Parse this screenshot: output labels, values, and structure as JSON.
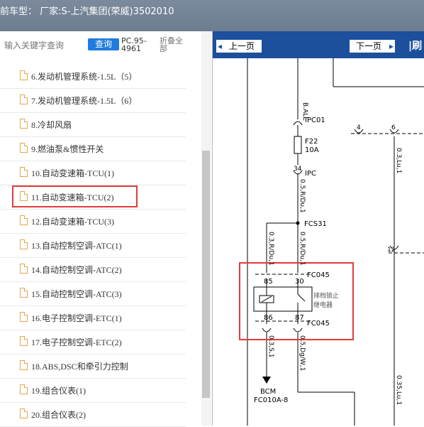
{
  "header": {
    "title": "前车型： 厂家:S-上汽集团(荣威)3502010"
  },
  "search": {
    "placeholder": "输入关键字查询",
    "button": "查询",
    "code": "PC.95-4961",
    "collapse": "折叠全部"
  },
  "tree": {
    "items": [
      {
        "label": "6.发动机管理系统-1.5L（5）"
      },
      {
        "label": "7.发动机管理系统-1.5L（6）"
      },
      {
        "label": "8.冷却风扇"
      },
      {
        "label": "9.燃油泵&惯性开关"
      },
      {
        "label": "10.自动变速箱-TCU(1)"
      },
      {
        "label": "11.自动变速箱-TCU(2)"
      },
      {
        "label": "12.自动变速箱-TCU(3)"
      },
      {
        "label": "13.自动控制空调-ATC(1)"
      },
      {
        "label": "14.自动控制空调-ATC(2)"
      },
      {
        "label": "15.自动控制空调-ATC(3)"
      },
      {
        "label": "16.电子控制空调-ETC(1)"
      },
      {
        "label": "17.电子控制空调-ETC(2)"
      },
      {
        "label": "18.ABS,DSC和牵引力控制"
      },
      {
        "label": "19.组合仪表(1)"
      },
      {
        "label": "20.组合仪表(2)"
      }
    ],
    "selected_index": 5
  },
  "viewer": {
    "prev": "上一页",
    "next": "下一页",
    "tail": "刷"
  },
  "diagram": {
    "texts": {
      "ball": "B.ALL",
      "ipc01": "IPC01",
      "fuse": "F22",
      "fuse_amp": "10A",
      "pin34": "34",
      "ipc": "IPC",
      "wire1": "0.5,R/Du,1",
      "fcs31": "FCS31",
      "wire2": "0.3,R/Du,1",
      "wire3": "0.5,R/Du,1",
      "p85": "85",
      "p30": "30",
      "fc045a": "FC045",
      "relay1": "排档锁止",
      "relay2": "继电器",
      "p86": "86",
      "p87": "87",
      "fc045b": "FC045",
      "wire4": "0.3,S,1",
      "wire5": "0.5,Dg/W,1",
      "bcm": "BCM",
      "bcmpin": "FC010A-8",
      "p4": "4",
      "p6": "6",
      "p12": "12",
      "wire6": "0.3,Lu,1",
      "wire7": "0.35,Lu,1"
    }
  }
}
